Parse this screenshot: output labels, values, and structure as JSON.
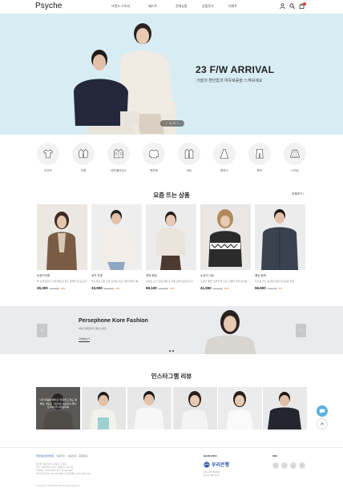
{
  "header": {
    "logo": "Psyche",
    "nav": [
      "브랜드 스토리",
      "베스트",
      "전체상품",
      "상품후기",
      "이벤트"
    ]
  },
  "hero": {
    "title": "23 F/W ARRIVAL",
    "subtitle": "가을의 편안함과 여유로움을 느껴보세요",
    "pager": "1 / 3"
  },
  "categories": [
    "티셔츠",
    "자켓",
    "셔츠/블라우스",
    "맨투맨",
    "코트",
    "원피스",
    "팬츠",
    "스커트"
  ],
  "popular": {
    "title": "요즘 뜨는 상품",
    "more": "전체보기 +",
    "items": [
      {
        "name": "트위드자켓",
        "desc": "울 소재 트위드 자켓 레트로 무드 클래식 핏 포근한 느낌",
        "price": "26,300",
        "orig": "29,000원",
        "pct": "10%"
      },
      {
        "name": "셔츠 자켓",
        "desc": "부드러운 코튼 소재 오버핏 셔츠 자켓 데일리 룩",
        "price": "33,900",
        "orig": "39,000원",
        "pct": "14%"
      },
      {
        "name": "푸퍼 패딩",
        "desc": "라이트 구스 다운 경량 숏 패딩 점퍼 보온성 우수",
        "price": "89,100",
        "orig": "99,000원",
        "pct": "10%"
      },
      {
        "name": "노르딕 니트",
        "desc": "노르딕 패턴 크루넥 울 니트 스웨터 겨울 필수템",
        "price": "41,650",
        "orig": "49,000원",
        "pct": "15%"
      },
      {
        "name": "패딩 점퍼",
        "desc": "미니멀 후드 숏 패딩 점퍼 남녀공용 방한",
        "price": "56,900",
        "orig": "59,900원",
        "pct": "5%"
      }
    ]
  },
  "banner2": {
    "title": "Persephone Kore Fashion",
    "subtitle": "여성 컨템포러리 패션 브랜드",
    "button": "자세히보기"
  },
  "instagram": {
    "title": "인스타그램 리뷰",
    "overlay": "너무 마음에 들어요! 따뜻하고 핏도 예뻐요. 색감도 사진이랑 똑같아서 좋아요 #싸이키 #데일리룩"
  },
  "footer": {
    "links": [
      "개인정보처리방침",
      "이용약관",
      "이용안내",
      "회원탈퇴"
    ],
    "info": [
      "상호명: 싸이키(주) | 대표자: 홍길동",
      "주소: 서울특별시 강남구 테헤란로 123, 5층",
      "전화번호: 1234-5678 | 팩스: 02-123-4567",
      "사업자등록번호: 123-45-67890 | 통신판매업: 2023-서울-1234"
    ],
    "copyright": "Copyright © 2023 PSYCHE. All rights reserved.",
    "bank_head": "BANK INFO",
    "bank_name": "우리은행",
    "bank_info": [
      "1234-567-890123",
      "예금주: 싸이키(주)"
    ],
    "sns_head": "SNS",
    "sns": [
      "f",
      "i",
      "y",
      "b"
    ]
  },
  "colors": {
    "hero_bg": "#d7edf3",
    "accent": "#2a5bb0",
    "sale": "#ff5a1f",
    "cart_badge": "#e53935"
  }
}
